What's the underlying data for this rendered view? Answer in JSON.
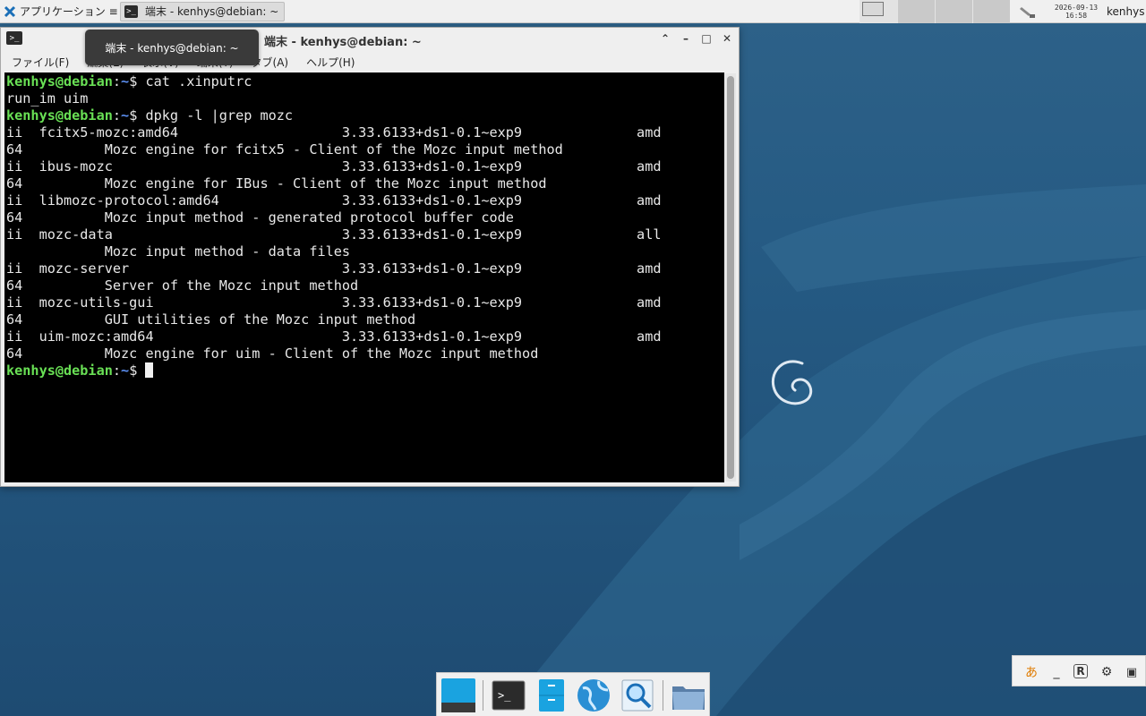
{
  "top_panel": {
    "apps_menu_label": "アプリケーション ≡",
    "task_button_label": "端末 - kenhys@debian: ~",
    "clock_date": "2026-09-13",
    "clock_time": "16:58",
    "user_name": "kenhys"
  },
  "window": {
    "title": "端末 - kenhys@debian: ~",
    "tooltip": "端末 - kenhys@debian: ~",
    "buttons": {
      "shade": "⌃",
      "minimize": "–",
      "maximize": "□",
      "close": "✕"
    },
    "menu": [
      "ファイル(F)",
      "編集(E)",
      "表示(V)",
      "端末(T)",
      "タブ(A)",
      "ヘルプ(H)"
    ]
  },
  "terminal": {
    "prompt_user": "kenhys@debian",
    "prompt_sep": ":",
    "prompt_path": "~",
    "prompt_dollar": "$ ",
    "cmd1": "cat .xinputrc",
    "out1": "run_im uim",
    "cmd2": "dpkg -l |grep mozc",
    "lines": [
      "ii  fcitx5-mozc:amd64                    3.33.6133+ds1-0.1~exp9              amd",
      "64          Mozc engine for fcitx5 - Client of the Mozc input method",
      "ii  ibus-mozc                            3.33.6133+ds1-0.1~exp9              amd",
      "64          Mozc engine for IBus - Client of the Mozc input method",
      "ii  libmozc-protocol:amd64               3.33.6133+ds1-0.1~exp9              amd",
      "64          Mozc input method - generated protocol buffer code",
      "ii  mozc-data                            3.33.6133+ds1-0.1~exp9              all",
      "            Mozc input method - data files",
      "ii  mozc-server                          3.33.6133+ds1-0.1~exp9              amd",
      "64          Server of the Mozc input method",
      "ii  mozc-utils-gui                       3.33.6133+ds1-0.1~exp9              amd",
      "64          GUI utilities of the Mozc input method",
      "ii  uim-mozc:amd64                       3.33.6133+ds1-0.1~exp9              amd",
      "64          Mozc engine for uim - Client of the Mozc input method"
    ]
  },
  "dock": {
    "items": [
      "show-desktop-icon",
      "terminal-icon",
      "file-manager-icon",
      "web-browser-icon",
      "app-finder-icon",
      "folder-icon"
    ]
  },
  "input_tray": {
    "icons": [
      "mozc-icon",
      "underscore-icon",
      "r-icon",
      "gear-icon",
      "window-icon"
    ],
    "r_label": "R"
  },
  "colors": {
    "prompt_user": "#69e055",
    "prompt_path": "#5b8ef0",
    "desktop": "#255a83"
  }
}
